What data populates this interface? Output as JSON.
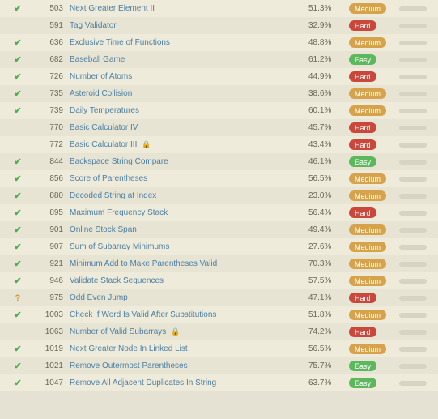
{
  "problems": [
    {
      "status": "done",
      "id": 503,
      "title": "Next Greater Element II",
      "locked": false,
      "accept": "51.3%",
      "difficulty": "Medium"
    },
    {
      "status": "",
      "id": 591,
      "title": "Tag Validator",
      "locked": false,
      "accept": "32.9%",
      "difficulty": "Hard"
    },
    {
      "status": "done",
      "id": 636,
      "title": "Exclusive Time of Functions",
      "locked": false,
      "accept": "48.8%",
      "difficulty": "Medium"
    },
    {
      "status": "done",
      "id": 682,
      "title": "Baseball Game",
      "locked": false,
      "accept": "61.2%",
      "difficulty": "Easy"
    },
    {
      "status": "done",
      "id": 726,
      "title": "Number of Atoms",
      "locked": false,
      "accept": "44.9%",
      "difficulty": "Hard"
    },
    {
      "status": "done",
      "id": 735,
      "title": "Asteroid Collision",
      "locked": false,
      "accept": "38.6%",
      "difficulty": "Medium"
    },
    {
      "status": "done",
      "id": 739,
      "title": "Daily Temperatures",
      "locked": false,
      "accept": "60.1%",
      "difficulty": "Medium"
    },
    {
      "status": "",
      "id": 770,
      "title": "Basic Calculator IV",
      "locked": false,
      "accept": "45.7%",
      "difficulty": "Hard"
    },
    {
      "status": "",
      "id": 772,
      "title": "Basic Calculator III",
      "locked": true,
      "accept": "43.4%",
      "difficulty": "Hard"
    },
    {
      "status": "done",
      "id": 844,
      "title": "Backspace String Compare",
      "locked": false,
      "accept": "46.1%",
      "difficulty": "Easy"
    },
    {
      "status": "done",
      "id": 856,
      "title": "Score of Parentheses",
      "locked": false,
      "accept": "56.5%",
      "difficulty": "Medium"
    },
    {
      "status": "done",
      "id": 880,
      "title": "Decoded String at Index",
      "locked": false,
      "accept": "23.0%",
      "difficulty": "Medium"
    },
    {
      "status": "done",
      "id": 895,
      "title": "Maximum Frequency Stack",
      "locked": false,
      "accept": "56.4%",
      "difficulty": "Hard"
    },
    {
      "status": "done",
      "id": 901,
      "title": "Online Stock Span",
      "locked": false,
      "accept": "49.4%",
      "difficulty": "Medium"
    },
    {
      "status": "done",
      "id": 907,
      "title": "Sum of Subarray Minimums",
      "locked": false,
      "accept": "27.6%",
      "difficulty": "Medium"
    },
    {
      "status": "done",
      "id": 921,
      "title": "Minimum Add to Make Parentheses Valid",
      "locked": false,
      "accept": "70.3%",
      "difficulty": "Medium"
    },
    {
      "status": "done",
      "id": 946,
      "title": "Validate Stack Sequences",
      "locked": false,
      "accept": "57.5%",
      "difficulty": "Medium"
    },
    {
      "status": "attempted",
      "id": 975,
      "title": "Odd Even Jump",
      "locked": false,
      "accept": "47.1%",
      "difficulty": "Hard"
    },
    {
      "status": "done",
      "id": 1003,
      "title": "Check If Word Is Valid After Substitutions",
      "locked": false,
      "accept": "51.8%",
      "difficulty": "Medium"
    },
    {
      "status": "",
      "id": 1063,
      "title": "Number of Valid Subarrays",
      "locked": true,
      "accept": "74.2%",
      "difficulty": "Hard"
    },
    {
      "status": "done",
      "id": 1019,
      "title": "Next Greater Node In Linked List",
      "locked": false,
      "accept": "56.5%",
      "difficulty": "Medium"
    },
    {
      "status": "done",
      "id": 1021,
      "title": "Remove Outermost Parentheses",
      "locked": false,
      "accept": "75.7%",
      "difficulty": "Easy"
    },
    {
      "status": "done",
      "id": 1047,
      "title": "Remove All Adjacent Duplicates In String",
      "locked": false,
      "accept": "63.7%",
      "difficulty": "Easy"
    }
  ]
}
